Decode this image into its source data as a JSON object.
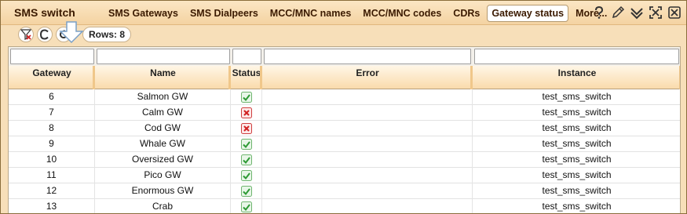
{
  "app_title": "SMS switch",
  "nav": [
    "SMS Gateways",
    "SMS Dialpeers",
    "MCC/MNC names",
    "MCC/MNC codes",
    "CDRs",
    "Gateway status",
    "More..."
  ],
  "active_nav": "Gateway status",
  "toolbar": {
    "rows_label": "Rows: 8"
  },
  "columns": [
    "Gateway",
    "Name",
    "Status",
    "Error",
    "Instance"
  ],
  "rows": [
    {
      "gateway": "6",
      "name": "Salmon GW",
      "status": "ok",
      "error": "",
      "instance": "test_sms_switch"
    },
    {
      "gateway": "7",
      "name": "Calm GW",
      "status": "error",
      "error": "",
      "instance": "test_sms_switch"
    },
    {
      "gateway": "8",
      "name": "Cod GW",
      "status": "error",
      "error": "",
      "instance": "test_sms_switch"
    },
    {
      "gateway": "9",
      "name": "Whale GW",
      "status": "ok",
      "error": "",
      "instance": "test_sms_switch"
    },
    {
      "gateway": "10",
      "name": "Oversized GW",
      "status": "ok",
      "error": "",
      "instance": "test_sms_switch"
    },
    {
      "gateway": "11",
      "name": "Pico GW",
      "status": "ok",
      "error": "",
      "instance": "test_sms_switch"
    },
    {
      "gateway": "12",
      "name": "Enormous GW",
      "status": "ok",
      "error": "",
      "instance": "test_sms_switch"
    },
    {
      "gateway": "13",
      "name": "Crab",
      "status": "ok",
      "error": "",
      "instance": "test_sms_switch"
    }
  ],
  "colors": {
    "header_bg": "#f4d3a2",
    "accent": "#3b1a00",
    "ok": "#3aa040",
    "error": "#d02020"
  },
  "icons": {
    "toolbar": [
      "filter-clear-icon",
      "clear-icon",
      "refresh-icon"
    ],
    "window": [
      "help-icon",
      "edit-icon",
      "collapse-icon",
      "detach-icon",
      "close-icon"
    ]
  }
}
